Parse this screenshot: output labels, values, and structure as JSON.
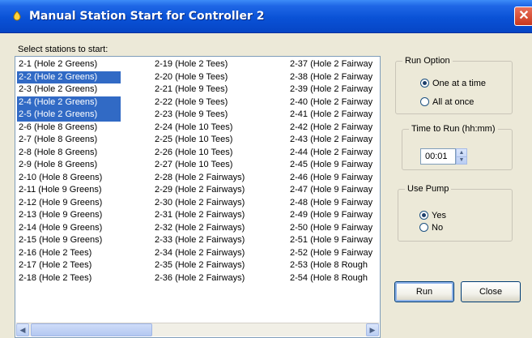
{
  "window": {
    "title": "Manual Station Start for Controller 2",
    "close_glyph": "✕"
  },
  "stations_label": "Select stations to start:",
  "stations": {
    "col1": [
      {
        "label": "2-1  (Hole 2 Greens)",
        "selected": false
      },
      {
        "label": "2-2  (Hole 2 Greens)",
        "selected": true
      },
      {
        "label": "2-3  (Hole 2 Greens)",
        "selected": false
      },
      {
        "label": "2-4  (Hole 2 Greens)",
        "selected": true
      },
      {
        "label": "2-5  (Hole 2 Greens)",
        "selected": true
      },
      {
        "label": "2-6  (Hole 8 Greens)",
        "selected": false
      },
      {
        "label": "2-7  (Hole 8 Greens)",
        "selected": false
      },
      {
        "label": "2-8  (Hole 8 Greens)",
        "selected": false
      },
      {
        "label": "2-9  (Hole 8 Greens)",
        "selected": false
      },
      {
        "label": "2-10  (Hole 8 Greens)",
        "selected": false
      },
      {
        "label": "2-11  (Hole 9 Greens)",
        "selected": false
      },
      {
        "label": "2-12  (Hole 9 Greens)",
        "selected": false
      },
      {
        "label": "2-13  (Hole 9 Greens)",
        "selected": false
      },
      {
        "label": "2-14  (Hole 9 Greens)",
        "selected": false
      },
      {
        "label": "2-15  (Hole 9 Greens)",
        "selected": false
      },
      {
        "label": "2-16  (Hole 2 Tees)",
        "selected": false
      },
      {
        "label": "2-17  (Hole 2 Tees)",
        "selected": false
      },
      {
        "label": "2-18  (Hole 2 Tees)",
        "selected": false
      }
    ],
    "col2": [
      {
        "label": "2-19  (Hole 2 Tees)",
        "selected": false
      },
      {
        "label": "2-20  (Hole 9 Tees)",
        "selected": false
      },
      {
        "label": "2-21  (Hole 9 Tees)",
        "selected": false
      },
      {
        "label": "2-22  (Hole 9 Tees)",
        "selected": false
      },
      {
        "label": "2-23  (Hole 9 Tees)",
        "selected": false
      },
      {
        "label": "2-24  (Hole 10 Tees)",
        "selected": false
      },
      {
        "label": "2-25  (Hole 10 Tees)",
        "selected": false
      },
      {
        "label": "2-26  (Hole 10 Tees)",
        "selected": false
      },
      {
        "label": "2-27  (Hole 10 Tees)",
        "selected": false
      },
      {
        "label": "2-28  (Hole 2 Fairways)",
        "selected": false
      },
      {
        "label": "2-29  (Hole 2 Fairways)",
        "selected": false
      },
      {
        "label": "2-30  (Hole 2 Fairways)",
        "selected": false
      },
      {
        "label": "2-31  (Hole 2 Fairways)",
        "selected": false
      },
      {
        "label": "2-32  (Hole 2 Fairways)",
        "selected": false
      },
      {
        "label": "2-33  (Hole 2 Fairways)",
        "selected": false
      },
      {
        "label": "2-34  (Hole 2 Fairways)",
        "selected": false
      },
      {
        "label": "2-35  (Hole 2 Fairways)",
        "selected": false
      },
      {
        "label": "2-36  (Hole 2 Fairways)",
        "selected": false
      }
    ],
    "col3": [
      {
        "label": "2-37  (Hole 2 Fairway",
        "selected": false
      },
      {
        "label": "2-38  (Hole 2 Fairway",
        "selected": false
      },
      {
        "label": "2-39  (Hole 2 Fairway",
        "selected": false
      },
      {
        "label": "2-40  (Hole 2 Fairway",
        "selected": false
      },
      {
        "label": "2-41  (Hole 2 Fairway",
        "selected": false
      },
      {
        "label": "2-42  (Hole 2 Fairway",
        "selected": false
      },
      {
        "label": "2-43  (Hole 2 Fairway",
        "selected": false
      },
      {
        "label": "2-44  (Hole 2 Fairway",
        "selected": false
      },
      {
        "label": "2-45  (Hole 9 Fairway",
        "selected": false
      },
      {
        "label": "2-46  (Hole 9 Fairway",
        "selected": false
      },
      {
        "label": "2-47  (Hole 9 Fairway",
        "selected": false
      },
      {
        "label": "2-48  (Hole 9 Fairway",
        "selected": false
      },
      {
        "label": "2-49  (Hole 9 Fairway",
        "selected": false
      },
      {
        "label": "2-50  (Hole 9 Fairway",
        "selected": false
      },
      {
        "label": "2-51  (Hole 9 Fairway",
        "selected": false
      },
      {
        "label": "2-52  (Hole 9 Fairway",
        "selected": false
      },
      {
        "label": "2-53  (Hole 8 Rough",
        "selected": false
      },
      {
        "label": "2-54  (Hole 8 Rough",
        "selected": false
      }
    ]
  },
  "scrollbar": {
    "left_arrow": "◀",
    "right_arrow": "▶"
  },
  "run_option": {
    "legend": "Run Option",
    "options": [
      {
        "label": "One at a time",
        "checked": true
      },
      {
        "label": "All at once",
        "checked": false
      }
    ]
  },
  "time_to_run": {
    "legend": "Time to Run (hh:mm)",
    "value": "00:01",
    "up": "▲",
    "down": "▼"
  },
  "use_pump": {
    "legend": "Use Pump",
    "options": [
      {
        "label": "Yes",
        "checked": true
      },
      {
        "label": "No",
        "checked": false
      }
    ]
  },
  "buttons": {
    "run": "Run",
    "close": "Close"
  }
}
